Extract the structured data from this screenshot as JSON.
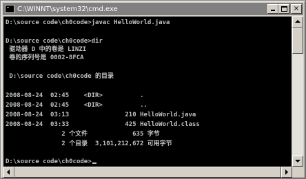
{
  "window": {
    "title": "C:\\WINNT\\system32\\cmd.exe",
    "icon": "console-icon"
  },
  "title_buttons": {
    "minimize": "minimize-icon",
    "maximize": "maximize-icon",
    "close_label": "×"
  },
  "console": {
    "lines": [
      "D:\\source code\\ch0code>javac HelloWorld.java",
      "",
      "D:\\source code\\ch0code>dir",
      " 驱动器 D 中的卷是 LINZI",
      " 卷的序列号是 0002-8FCA",
      "",
      " D:\\source code\\ch0code 的目录",
      "",
      "2008-08-24  02:45    <DIR>          .",
      "2008-08-24  02:45    <DIR>          ..",
      "2008-08-24  03:13               210 HelloWorld.java",
      "2008-08-24  03:33               425 HelloWorld.class",
      "               2 个文件            635 字节",
      "               2 个目录  3,101,212,672 可用字节",
      "",
      "D:\\source code\\ch0code>"
    ]
  },
  "colors": {
    "console_background": "#000000",
    "console_text": "#c0c0c0",
    "titlebar": "#808080",
    "chrome": "#d4d0c8"
  }
}
